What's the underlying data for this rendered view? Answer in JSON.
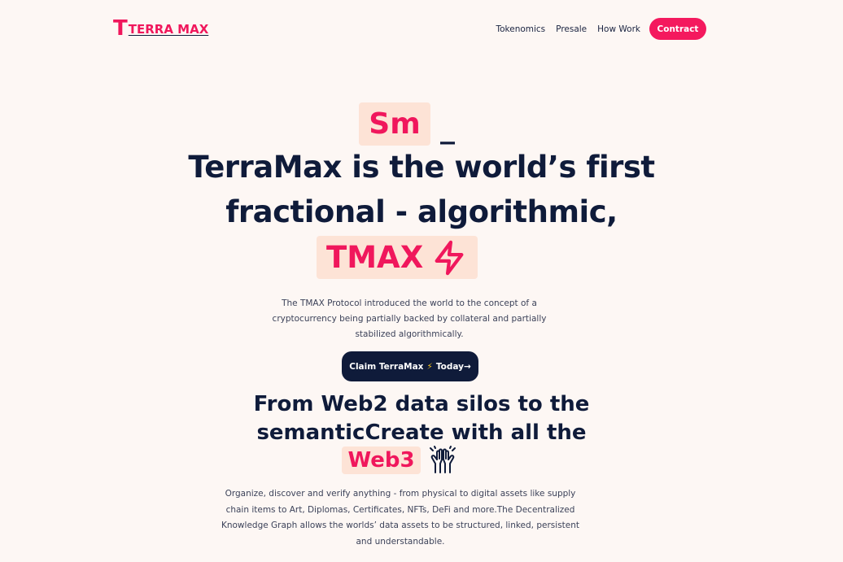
{
  "header": {
    "logo_letter": "T",
    "logo_text": "TERRA MAX",
    "nav": [
      "Tokenomics",
      "Presale",
      "How Work"
    ],
    "contract_label": "Contract"
  },
  "hero": {
    "typed_text": "Sm",
    "cursor": "_",
    "line1": "TerraMax is the world’s first",
    "line2": "fractional - algorithmic,",
    "highlight": "TMAX",
    "description": "The TMAX Protocol introduced the world to the concept of a cryptocurrency being partially backed by collateral and partially stabilized algorithmically.",
    "cta_prefix": "Claim TerraMax",
    "cta_bolt": "⚡",
    "cta_suffix": "Today→"
  },
  "section": {
    "line1": "From Web2 data silos to the",
    "line2": "semanticCreate with all the",
    "highlight": "Web3",
    "description": "Organize, discover and verify anything - from physical to digital assets like supply chain items to Art, Diplomas, Certificates, NFTs, DeFi and more.The Decentralized Knowledge Graph allows the worlds’ data assets to be structured, linked, persistent and understandable."
  },
  "icons": {
    "bolt": "lightning-bolt-icon",
    "hands": "raised-hands-icon"
  },
  "colors": {
    "background": "#fdf7f4",
    "accent": "#f0175c",
    "highlight_bg": "#fde3d6",
    "dark": "#0f1b3a"
  }
}
